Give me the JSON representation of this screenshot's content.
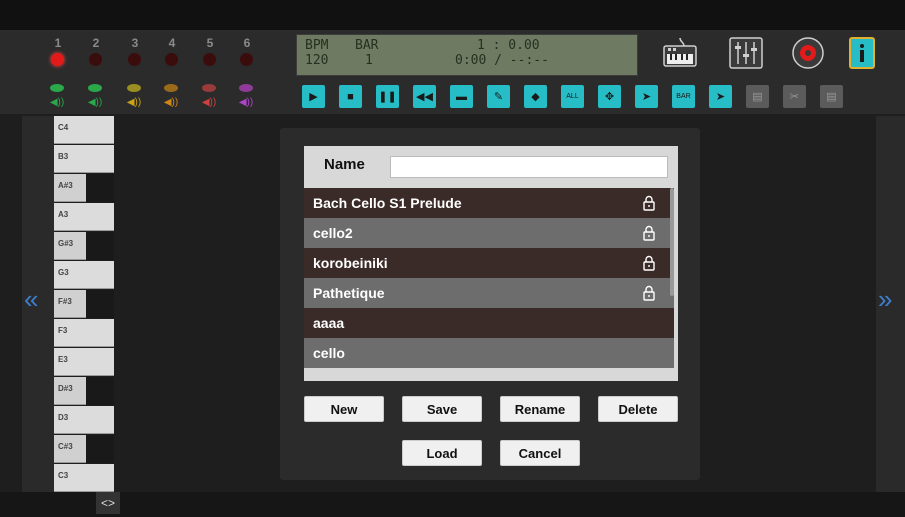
{
  "toolbar": {
    "tracks": [
      {
        "number": "1",
        "color": "#2aa84a",
        "spk_color": "#2aa84a"
      },
      {
        "number": "2",
        "color": "#2aa84a",
        "spk_color": "#2aa84a"
      },
      {
        "number": "3",
        "color": "#9a8d22",
        "spk_color": "#c9a516"
      },
      {
        "number": "4",
        "color": "#9a6a1a",
        "spk_color": "#d08616"
      },
      {
        "number": "5",
        "color": "#9a3b3b",
        "spk_color": "#d04040"
      },
      {
        "number": "6",
        "color": "#8f3b9a",
        "spk_color": "#b044c8"
      }
    ],
    "record_active_index": 0,
    "lcd": {
      "bpm_label": "BPM",
      "bpm_value": "120",
      "bar_label": "BAR",
      "bar_value": "1",
      "position": "1 : 0.00",
      "time": "0:00 / --:--"
    },
    "tools": [
      {
        "name": "play-icon",
        "glyph": "▶",
        "style": "bright"
      },
      {
        "name": "stop-icon",
        "glyph": "■",
        "style": "bright"
      },
      {
        "name": "pause-icon",
        "glyph": "❚❚",
        "style": "bright"
      },
      {
        "name": "rewind-icon",
        "glyph": "◀◀",
        "style": "bright"
      },
      {
        "name": "save-file-icon",
        "glyph": "▬",
        "style": "bright"
      },
      {
        "name": "pencil-icon",
        "glyph": "✎",
        "style": "bright"
      },
      {
        "name": "eraser-icon",
        "glyph": "◆",
        "style": "bright"
      },
      {
        "name": "select-all-icon",
        "glyph": "ALL",
        "style": "bright"
      },
      {
        "name": "move-icon",
        "glyph": "✥",
        "style": "bright"
      },
      {
        "name": "select-icon",
        "glyph": "➤",
        "style": "bright"
      },
      {
        "name": "bar-select-icon",
        "glyph": "BAR",
        "style": "bright"
      },
      {
        "name": "marker-icon",
        "glyph": "➤",
        "style": "bright"
      },
      {
        "name": "copy-icon",
        "glyph": "▤",
        "style": "dim"
      },
      {
        "name": "cut-icon",
        "glyph": "✂",
        "style": "dim"
      },
      {
        "name": "paste-icon",
        "glyph": "▤",
        "style": "dim"
      }
    ]
  },
  "piano": {
    "keys": [
      {
        "label": "C4",
        "sharp": false
      },
      {
        "label": "B3",
        "sharp": false
      },
      {
        "label": "A#3",
        "sharp": true
      },
      {
        "label": "A3",
        "sharp": false
      },
      {
        "label": "G#3",
        "sharp": true
      },
      {
        "label": "G3",
        "sharp": false
      },
      {
        "label": "F#3",
        "sharp": true
      },
      {
        "label": "F3",
        "sharp": false
      },
      {
        "label": "E3",
        "sharp": false
      },
      {
        "label": "D#3",
        "sharp": true
      },
      {
        "label": "D3",
        "sharp": false
      },
      {
        "label": "C#3",
        "sharp": true
      },
      {
        "label": "C3",
        "sharp": false
      }
    ]
  },
  "nav": {
    "left_arrow": "«",
    "right_arrow": "»",
    "bottom_toggle": "<>"
  },
  "dialog": {
    "name_label": "Name",
    "name_value": "",
    "files": [
      {
        "name": "Bach Cello S1 Prelude",
        "locked": true
      },
      {
        "name": "cello2",
        "locked": true
      },
      {
        "name": "korobeiniki",
        "locked": true
      },
      {
        "name": "Pathetique",
        "locked": true
      },
      {
        "name": "aaaa",
        "locked": false
      },
      {
        "name": "cello",
        "locked": false
      }
    ],
    "buttons": {
      "new": "New",
      "save": "Save",
      "rename": "Rename",
      "delete": "Delete",
      "load": "Load",
      "cancel": "Cancel"
    }
  }
}
